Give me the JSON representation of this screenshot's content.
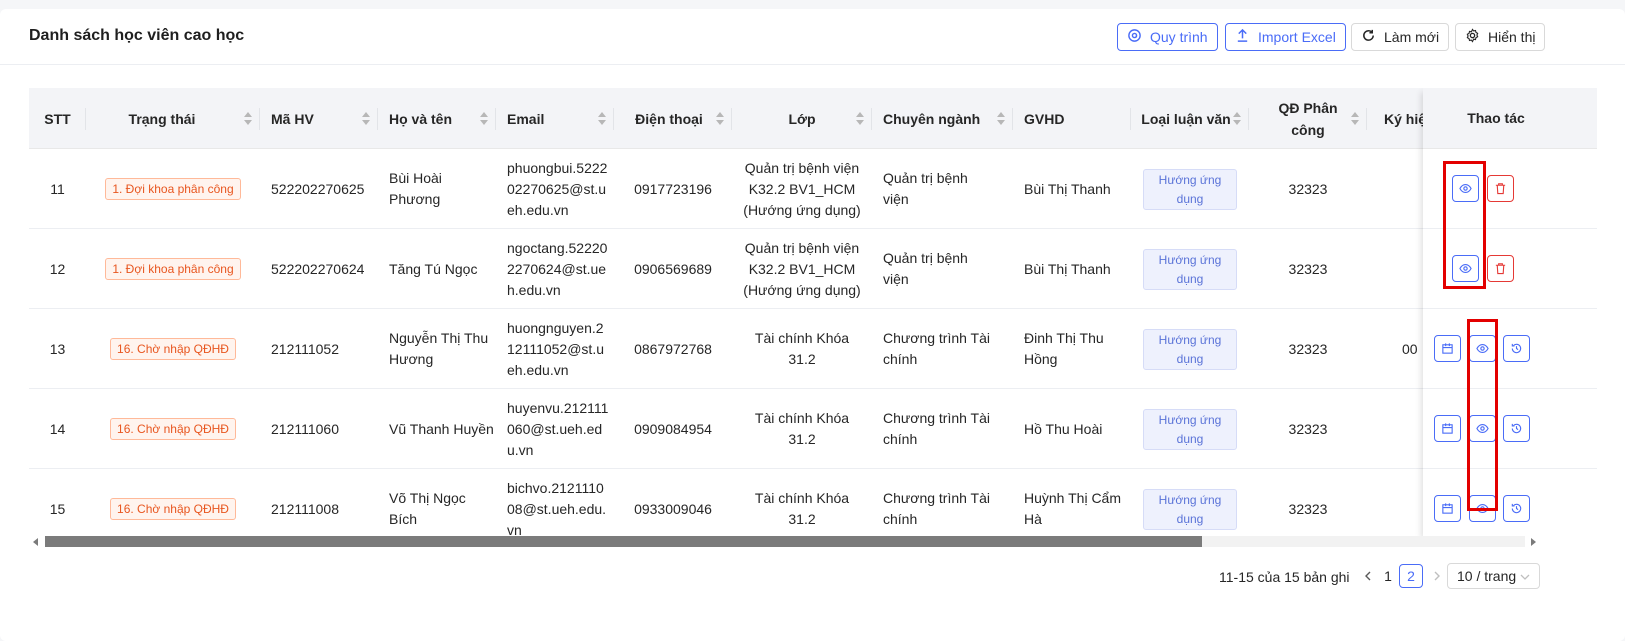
{
  "header": {
    "title": "Danh sách học viên cao học",
    "buttons": {
      "process": "Quy trình",
      "import": "Import Excel",
      "refresh": "Làm mới",
      "display": "Hiển thị"
    }
  },
  "table": {
    "columns": [
      "STT",
      "Trạng thái",
      "Mã HV",
      "Họ và tên",
      "Email",
      "Điện thoại",
      "Lớp",
      "Chuyên ngành",
      "GVHD",
      "Loại luận văn",
      "QĐ Phân công",
      "Ký hiệ",
      "Thao tác"
    ],
    "rows": [
      {
        "stt": "11",
        "status": "1. Đợi khoa phân công",
        "code": "522202270625",
        "name": "Bùi Hoài Phương",
        "email": "phuongbui.522202270625@st.ueh.edu.vn",
        "phone": "0917723196",
        "class": "Quản trị bệnh viện K32.2 BV1_HCM (Hướng ứng dụng)",
        "major": "Quản trị bệnh viện",
        "advisor": "Bùi Thị Thanh",
        "thesis_type": "Hướng ứng dụng",
        "decision": "32323",
        "symbol": ""
      },
      {
        "stt": "12",
        "status": "1. Đợi khoa phân công",
        "code": "522202270624",
        "name": "Tăng Tú Ngọc",
        "email": "ngoctang.522202270624@st.ueh.edu.vn",
        "phone": "0906569689",
        "class": "Quản trị bệnh viện K32.2 BV1_HCM (Hướng ứng dụng)",
        "major": "Quản trị bệnh viện",
        "advisor": "Bùi Thị Thanh",
        "thesis_type": "Hướng ứng dụng",
        "decision": "32323",
        "symbol": ""
      },
      {
        "stt": "13",
        "status": "16. Chờ nhập QĐHĐ",
        "code": "212111052",
        "name": "Nguyễn Thị Thu Hương",
        "email": "huongnguyen.212111052@st.ueh.edu.vn",
        "phone": "0867972768",
        "class": "Tài chính Khóa 31.2",
        "major": "Chương trình Tài chính",
        "advisor": "Đinh Thị Thu Hồng",
        "thesis_type": "Hướng ứng dụng",
        "decision": "32323",
        "symbol": "00"
      },
      {
        "stt": "14",
        "status": "16. Chờ nhập QĐHĐ",
        "code": "212111060",
        "name": "Vũ Thanh Huyền",
        "email": "huyenvu.212111060@st.ueh.edu.vn",
        "phone": "0909084954",
        "class": "Tài chính Khóa 31.2",
        "major": "Chương trình Tài chính",
        "advisor": "Hồ Thu Hoài",
        "thesis_type": "Hướng ứng dụng",
        "decision": "32323",
        "symbol": ""
      },
      {
        "stt": "15",
        "status": "16. Chờ nhập QĐHĐ",
        "code": "212111008",
        "name": "Võ Thị Ngọc Bích",
        "email": "bichvo.212111008@st.ueh.edu.vn",
        "phone": "0933009046",
        "class": "Tài chính Khóa 31.2",
        "major": "Chương trình Tài chính",
        "advisor": "Huỳnh Thị Cẩm Hà",
        "thesis_type": "Hướng ứng dụng",
        "decision": "32323",
        "symbol": ""
      }
    ]
  },
  "pagination": {
    "summary": "11-15 của 15 bản ghi",
    "pages": [
      "1",
      "2"
    ],
    "current": "2",
    "page_size": "10 / trang"
  },
  "colors": {
    "primary": "#4a6cf7",
    "danger": "#e53935",
    "status_tag": "#e8561f",
    "highlight": "#e30000"
  }
}
